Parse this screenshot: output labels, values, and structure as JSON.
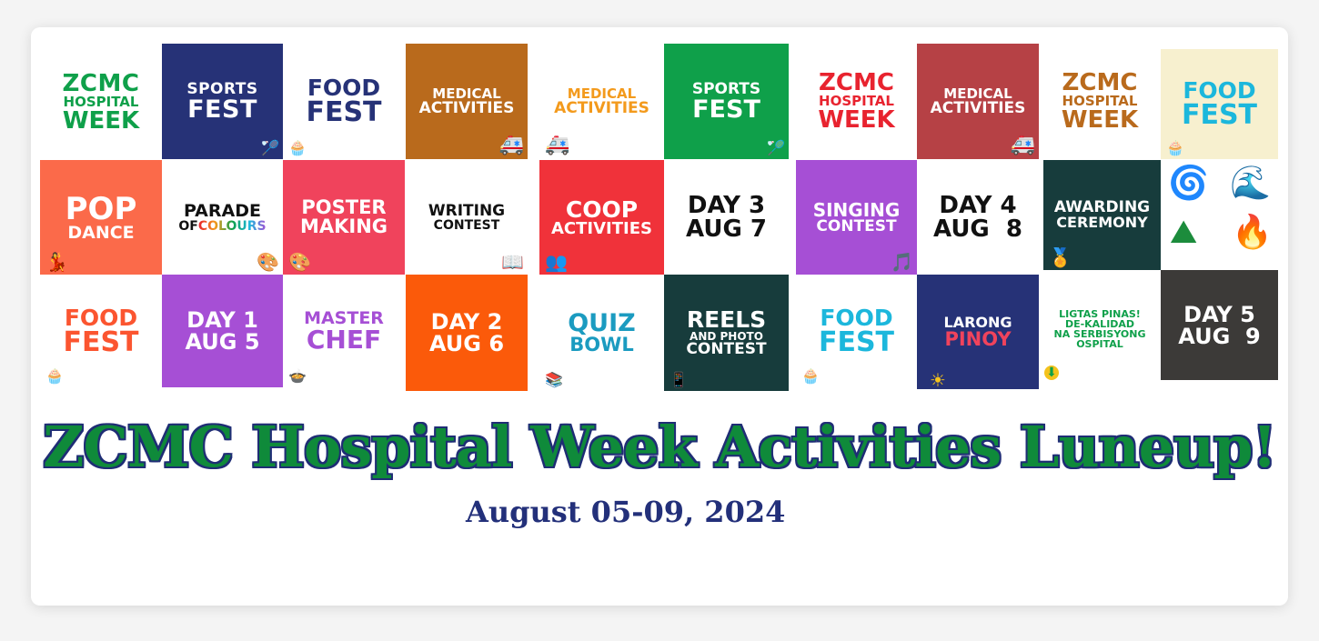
{
  "tiles": {
    "r1c1": {
      "l1": "ZCMC",
      "l2": "HOSPITAL",
      "l3": "WEEK"
    },
    "r1c2": {
      "l1": "SPORTS",
      "l2": "FEST",
      "icon": "🏸"
    },
    "r1c3": {
      "l1": "FOOD",
      "l2": "FEST",
      "icon": "🧁"
    },
    "r1c4": {
      "l1": "MEDICAL",
      "l2": "ACTIVITIES",
      "icon": "🚑"
    },
    "r1c5": {
      "l1": "MEDICAL",
      "l2": "ACTIVITIES",
      "icon": "🚑"
    },
    "r1c6": {
      "l1": "SPORTS",
      "l2": "FEST",
      "icon": "🏸"
    },
    "r1c7": {
      "l1": "ZCMC",
      "l2": "HOSPITAL",
      "l3": "WEEK"
    },
    "r1c8": {
      "l1": "MEDICAL",
      "l2": "ACTIVITIES",
      "icon": "🚑"
    },
    "r1c9": {
      "l1": "ZCMC",
      "l2": "HOSPITAL",
      "l3": "WEEK"
    },
    "r1c10": {
      "l1": "FOOD",
      "l2": "FEST",
      "icon": "🧁"
    },
    "r2c1": {
      "l1": "POP",
      "l2": "DANCE",
      "icon": "💃"
    },
    "r2c2": {
      "l1": "PARADE",
      "l2a": "OF",
      "l2b": "COLOURS",
      "icon": "🎨"
    },
    "r2c3": {
      "l1": "POSTER",
      "l2": "MAKING",
      "icon": "🎨"
    },
    "r2c4": {
      "l1": "WRITING",
      "l2": "CONTEST",
      "icon": "📖"
    },
    "r2c5": {
      "l1": "COOP",
      "l2": "ACTIVITIES",
      "icon": "👥"
    },
    "r2c6": {
      "l1": "DAY 3",
      "l2": "AUG 7"
    },
    "r2c7": {
      "l1": "SINGING",
      "l2": "CONTEST",
      "icon": "🎵"
    },
    "r2c8": {
      "l1": "DAY 4",
      "l2": "AUG  8"
    },
    "r2c9": {
      "l1": "AWARDING",
      "l2": "CEREMONY",
      "icon": "🏅"
    },
    "r2c10": {
      "icons": [
        "🌀",
        "🌊",
        "⛰",
        "🔥"
      ]
    },
    "r3c1": {
      "l1": "FOOD",
      "l2": "FEST",
      "icon": "🧁"
    },
    "r3c2": {
      "l1": "DAY 1",
      "l2": "AUG 5"
    },
    "r3c3": {
      "l1": "MASTER",
      "l2": "CHEF",
      "icon": "🍲"
    },
    "r3c4": {
      "l1": "DAY 2",
      "l2": "AUG 6"
    },
    "r3c5": {
      "l1": "QUIZ",
      "l2": "BOWL",
      "icon": "📚"
    },
    "r3c6": {
      "l1": "REELS",
      "l2": "AND PHOTO",
      "l3": "CONTEST",
      "icon": "📱"
    },
    "r3c7": {
      "l1": "FOOD",
      "l2": "FEST",
      "icon": "🧁"
    },
    "r3c8": {
      "l1": "LARONG",
      "l2": "PINOY",
      "icon": "☀"
    },
    "r3c9": {
      "l1": "LIGTAS PINAS!",
      "l2": "DE-KALIDAD",
      "l3": "NA SERBISYONG",
      "l4": "OSPITAL",
      "icon": "⬇"
    },
    "r3c10": {
      "l1": "DAY 5",
      "l2": "AUG  9"
    }
  },
  "title": "ZCMC Hospital Week Activities Luneup!",
  "subtitle": "August 05-09, 2024",
  "colors": {
    "green": "#0fa04a",
    "navy": "#263277",
    "brown": "#b96a1c",
    "red": "#e8232f",
    "orange": "#fb5530",
    "pink": "#f0435c",
    "purple": "#a64fd5",
    "teal": "#173c3c",
    "cyan": "#1cb7dc",
    "cream": "#f7f0cf",
    "darkred": "#b64145",
    "dark": "#3c3a38",
    "title_green": "#0f8a3a"
  }
}
